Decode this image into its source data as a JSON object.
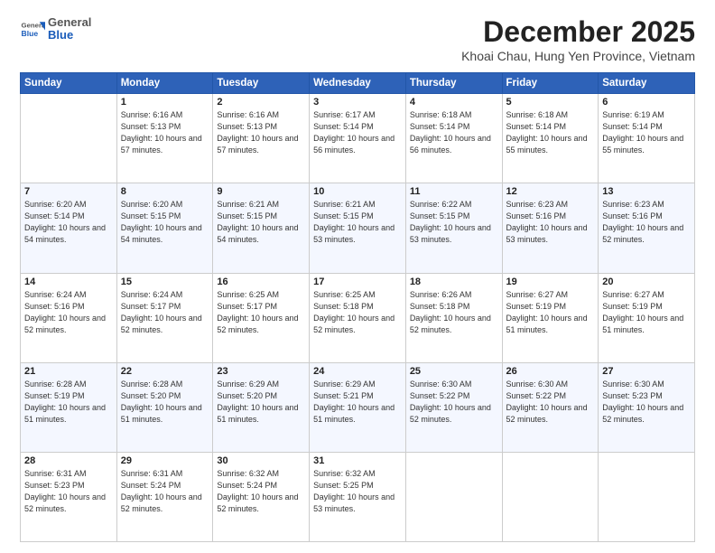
{
  "app": {
    "logo_general": "General",
    "logo_blue": "Blue"
  },
  "header": {
    "month": "December 2025",
    "location": "Khoai Chau, Hung Yen Province, Vietnam"
  },
  "weekdays": [
    "Sunday",
    "Monday",
    "Tuesday",
    "Wednesday",
    "Thursday",
    "Friday",
    "Saturday"
  ],
  "weeks": [
    [
      {
        "date": "",
        "sunrise": "",
        "sunset": "",
        "daylight": ""
      },
      {
        "date": "1",
        "sunrise": "Sunrise: 6:16 AM",
        "sunset": "Sunset: 5:13 PM",
        "daylight": "Daylight: 10 hours and 57 minutes."
      },
      {
        "date": "2",
        "sunrise": "Sunrise: 6:16 AM",
        "sunset": "Sunset: 5:13 PM",
        "daylight": "Daylight: 10 hours and 57 minutes."
      },
      {
        "date": "3",
        "sunrise": "Sunrise: 6:17 AM",
        "sunset": "Sunset: 5:14 PM",
        "daylight": "Daylight: 10 hours and 56 minutes."
      },
      {
        "date": "4",
        "sunrise": "Sunrise: 6:18 AM",
        "sunset": "Sunset: 5:14 PM",
        "daylight": "Daylight: 10 hours and 56 minutes."
      },
      {
        "date": "5",
        "sunrise": "Sunrise: 6:18 AM",
        "sunset": "Sunset: 5:14 PM",
        "daylight": "Daylight: 10 hours and 55 minutes."
      },
      {
        "date": "6",
        "sunrise": "Sunrise: 6:19 AM",
        "sunset": "Sunset: 5:14 PM",
        "daylight": "Daylight: 10 hours and 55 minutes."
      }
    ],
    [
      {
        "date": "7",
        "sunrise": "Sunrise: 6:20 AM",
        "sunset": "Sunset: 5:14 PM",
        "daylight": "Daylight: 10 hours and 54 minutes."
      },
      {
        "date": "8",
        "sunrise": "Sunrise: 6:20 AM",
        "sunset": "Sunset: 5:15 PM",
        "daylight": "Daylight: 10 hours and 54 minutes."
      },
      {
        "date": "9",
        "sunrise": "Sunrise: 6:21 AM",
        "sunset": "Sunset: 5:15 PM",
        "daylight": "Daylight: 10 hours and 54 minutes."
      },
      {
        "date": "10",
        "sunrise": "Sunrise: 6:21 AM",
        "sunset": "Sunset: 5:15 PM",
        "daylight": "Daylight: 10 hours and 53 minutes."
      },
      {
        "date": "11",
        "sunrise": "Sunrise: 6:22 AM",
        "sunset": "Sunset: 5:15 PM",
        "daylight": "Daylight: 10 hours and 53 minutes."
      },
      {
        "date": "12",
        "sunrise": "Sunrise: 6:23 AM",
        "sunset": "Sunset: 5:16 PM",
        "daylight": "Daylight: 10 hours and 53 minutes."
      },
      {
        "date": "13",
        "sunrise": "Sunrise: 6:23 AM",
        "sunset": "Sunset: 5:16 PM",
        "daylight": "Daylight: 10 hours and 52 minutes."
      }
    ],
    [
      {
        "date": "14",
        "sunrise": "Sunrise: 6:24 AM",
        "sunset": "Sunset: 5:16 PM",
        "daylight": "Daylight: 10 hours and 52 minutes."
      },
      {
        "date": "15",
        "sunrise": "Sunrise: 6:24 AM",
        "sunset": "Sunset: 5:17 PM",
        "daylight": "Daylight: 10 hours and 52 minutes."
      },
      {
        "date": "16",
        "sunrise": "Sunrise: 6:25 AM",
        "sunset": "Sunset: 5:17 PM",
        "daylight": "Daylight: 10 hours and 52 minutes."
      },
      {
        "date": "17",
        "sunrise": "Sunrise: 6:25 AM",
        "sunset": "Sunset: 5:18 PM",
        "daylight": "Daylight: 10 hours and 52 minutes."
      },
      {
        "date": "18",
        "sunrise": "Sunrise: 6:26 AM",
        "sunset": "Sunset: 5:18 PM",
        "daylight": "Daylight: 10 hours and 52 minutes."
      },
      {
        "date": "19",
        "sunrise": "Sunrise: 6:27 AM",
        "sunset": "Sunset: 5:19 PM",
        "daylight": "Daylight: 10 hours and 51 minutes."
      },
      {
        "date": "20",
        "sunrise": "Sunrise: 6:27 AM",
        "sunset": "Sunset: 5:19 PM",
        "daylight": "Daylight: 10 hours and 51 minutes."
      }
    ],
    [
      {
        "date": "21",
        "sunrise": "Sunrise: 6:28 AM",
        "sunset": "Sunset: 5:19 PM",
        "daylight": "Daylight: 10 hours and 51 minutes."
      },
      {
        "date": "22",
        "sunrise": "Sunrise: 6:28 AM",
        "sunset": "Sunset: 5:20 PM",
        "daylight": "Daylight: 10 hours and 51 minutes."
      },
      {
        "date": "23",
        "sunrise": "Sunrise: 6:29 AM",
        "sunset": "Sunset: 5:20 PM",
        "daylight": "Daylight: 10 hours and 51 minutes."
      },
      {
        "date": "24",
        "sunrise": "Sunrise: 6:29 AM",
        "sunset": "Sunset: 5:21 PM",
        "daylight": "Daylight: 10 hours and 51 minutes."
      },
      {
        "date": "25",
        "sunrise": "Sunrise: 6:30 AM",
        "sunset": "Sunset: 5:22 PM",
        "daylight": "Daylight: 10 hours and 52 minutes."
      },
      {
        "date": "26",
        "sunrise": "Sunrise: 6:30 AM",
        "sunset": "Sunset: 5:22 PM",
        "daylight": "Daylight: 10 hours and 52 minutes."
      },
      {
        "date": "27",
        "sunrise": "Sunrise: 6:30 AM",
        "sunset": "Sunset: 5:23 PM",
        "daylight": "Daylight: 10 hours and 52 minutes."
      }
    ],
    [
      {
        "date": "28",
        "sunrise": "Sunrise: 6:31 AM",
        "sunset": "Sunset: 5:23 PM",
        "daylight": "Daylight: 10 hours and 52 minutes."
      },
      {
        "date": "29",
        "sunrise": "Sunrise: 6:31 AM",
        "sunset": "Sunset: 5:24 PM",
        "daylight": "Daylight: 10 hours and 52 minutes."
      },
      {
        "date": "30",
        "sunrise": "Sunrise: 6:32 AM",
        "sunset": "Sunset: 5:24 PM",
        "daylight": "Daylight: 10 hours and 52 minutes."
      },
      {
        "date": "31",
        "sunrise": "Sunrise: 6:32 AM",
        "sunset": "Sunset: 5:25 PM",
        "daylight": "Daylight: 10 hours and 53 minutes."
      },
      {
        "date": "",
        "sunrise": "",
        "sunset": "",
        "daylight": ""
      },
      {
        "date": "",
        "sunrise": "",
        "sunset": "",
        "daylight": ""
      },
      {
        "date": "",
        "sunrise": "",
        "sunset": "",
        "daylight": ""
      }
    ]
  ]
}
